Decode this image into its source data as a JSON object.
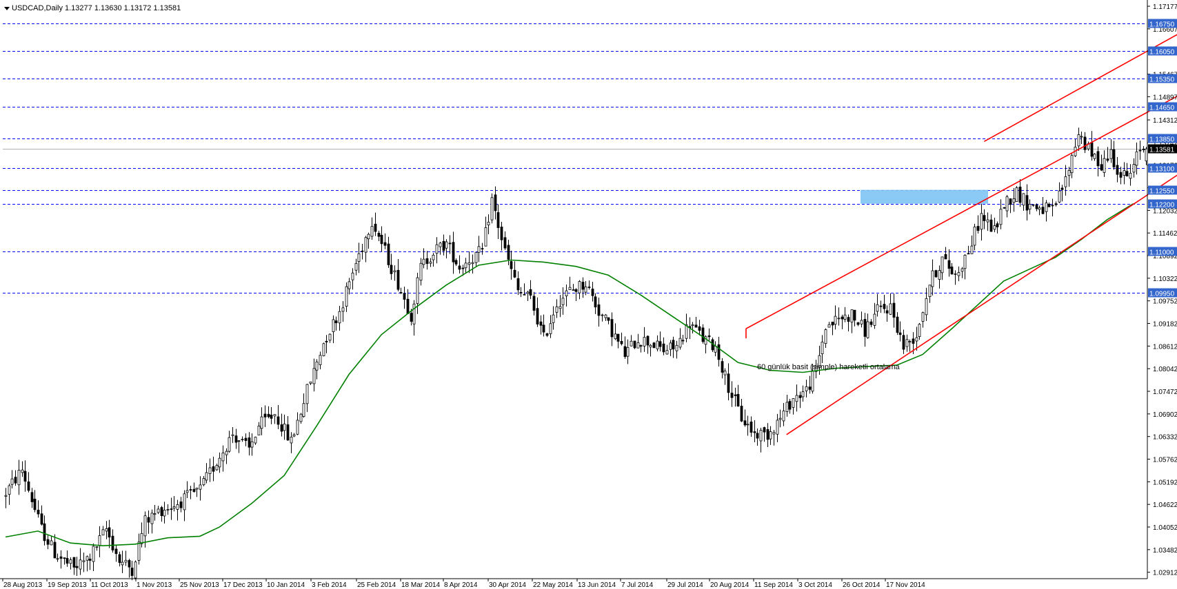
{
  "header": {
    "symbol_line": "USDCAD,Daily  1.13277 1.13630 1.13172 1.13581"
  },
  "annotation": {
    "text": "60 günlük basit (simple) hareketli ortalama"
  },
  "colors": {
    "candle": "#000000",
    "channel": "#ff0000",
    "ma": "#008000",
    "level_line": "#0000ff",
    "level_label_bg": "#3366cc",
    "current_label_bg": "#000000",
    "zone": "#7fc4f5"
  },
  "chart_data": {
    "type": "candlestick",
    "symbol": "USDCAD",
    "timeframe": "Daily",
    "last_bar": {
      "open": 1.13277,
      "high": 1.1363,
      "low": 1.13172,
      "close": 1.13581
    },
    "x_tick_labels": [
      "28 Aug 2013",
      "19 Sep 2013",
      "11 Oct 2013",
      "1 Nov 2013",
      "25 Nov 2013",
      "17 Dec 2013",
      "10 Jan 2014",
      "3 Feb 2014",
      "25 Feb 2014",
      "18 Mar 2014",
      "8 Apr 2014",
      "30 Apr 2014",
      "22 May 2014",
      "13 Jun 2014",
      "7 Jul 2014",
      "29 Jul 2014",
      "20 Aug 2014",
      "11 Sep 2014",
      "3 Oct 2014",
      "26 Oct 2014",
      "17 Nov 2014"
    ],
    "y_tick_labels": [
      "1.17177",
      "1.16607",
      "1.16037",
      "1.15467",
      "1.14897",
      "1.14312",
      "1.13742",
      "1.13172",
      "1.12602",
      "1.12032",
      "1.11462",
      "1.10892",
      "1.10322",
      "1.09752",
      "1.09182",
      "1.08612",
      "1.08042",
      "1.07472",
      "1.06902",
      "1.06332",
      "1.05762",
      "1.05192",
      "1.04622",
      "1.04052",
      "1.03482",
      "1.02912"
    ],
    "ylim": [
      1.0275,
      1.1723
    ],
    "horizontal_levels": [
      "1.16750",
      "1.16050",
      "1.15350",
      "1.14650",
      "1.13850",
      "1.13100",
      "1.12550",
      "1.12200",
      "1.11000",
      "1.09950"
    ],
    "current_price": "1.13581",
    "highlight_zone": {
      "from": 1.122,
      "to": 1.1255
    },
    "moving_average": {
      "period": 60,
      "type": "simple"
    },
    "price_path": [
      [
        0,
        1.048
      ],
      [
        6,
        1.055
      ],
      [
        12,
        1.04
      ],
      [
        16,
        1.034
      ],
      [
        22,
        1.03
      ],
      [
        27,
        1.033
      ],
      [
        32,
        1.04
      ],
      [
        36,
        1.032
      ],
      [
        40,
        1.03
      ],
      [
        44,
        1.042
      ],
      [
        49,
        1.045
      ],
      [
        53,
        1.046
      ],
      [
        57,
        1.048
      ],
      [
        61,
        1.05
      ],
      [
        66,
        1.057
      ],
      [
        71,
        1.064
      ],
      [
        76,
        1.06
      ],
      [
        79,
        1.066
      ],
      [
        84,
        1.069
      ],
      [
        89,
        1.062
      ],
      [
        94,
        1.075
      ],
      [
        99,
        1.087
      ],
      [
        104,
        1.095
      ],
      [
        109,
        1.107
      ],
      [
        114,
        1.118
      ],
      [
        118,
        1.11
      ],
      [
        122,
        1.102
      ],
      [
        126,
        1.094
      ],
      [
        129,
        1.106
      ],
      [
        133,
        1.11
      ],
      [
        137,
        1.112
      ],
      [
        141,
        1.106
      ],
      [
        144,
        1.108
      ],
      [
        148,
        1.11
      ],
      [
        151,
        1.123
      ],
      [
        155,
        1.11
      ],
      [
        159,
        1.1
      ],
      [
        163,
        1.098
      ],
      [
        167,
        1.088
      ],
      [
        171,
        1.097
      ],
      [
        175,
        1.1
      ],
      [
        180,
        1.102
      ],
      [
        184,
        1.095
      ],
      [
        188,
        1.09
      ],
      [
        192,
        1.084
      ],
      [
        196,
        1.088
      ],
      [
        200,
        1.087
      ],
      [
        204,
        1.085
      ],
      [
        208,
        1.086
      ],
      [
        212,
        1.092
      ],
      [
        216,
        1.088
      ],
      [
        220,
        1.086
      ],
      [
        224,
        1.076
      ],
      [
        228,
        1.068
      ],
      [
        232,
        1.064
      ],
      [
        236,
        1.064
      ],
      [
        240,
        1.068
      ],
      [
        244,
        1.073
      ],
      [
        248,
        1.075
      ],
      [
        251,
        1.08
      ],
      [
        254,
        1.091
      ],
      [
        258,
        1.093
      ],
      [
        262,
        1.094
      ],
      [
        266,
        1.09
      ],
      [
        270,
        1.095
      ],
      [
        274,
        1.096
      ],
      [
        278,
        1.086
      ],
      [
        282,
        1.089
      ],
      [
        286,
        1.102
      ],
      [
        290,
        1.108
      ],
      [
        294,
        1.104
      ],
      [
        298,
        1.11
      ],
      [
        302,
        1.119
      ],
      [
        306,
        1.115
      ],
      [
        309,
        1.122
      ],
      [
        313,
        1.125
      ],
      [
        316,
        1.122
      ],
      [
        320,
        1.121
      ],
      [
        324,
        1.12
      ],
      [
        328,
        1.128
      ],
      [
        332,
        1.14
      ],
      [
        336,
        1.134
      ],
      [
        339,
        1.132
      ],
      [
        342,
        1.135
      ],
      [
        345,
        1.129
      ],
      [
        348,
        1.129
      ],
      [
        351,
        1.136
      ],
      [
        352,
        1.1358
      ]
    ],
    "ma_path": [
      [
        0,
        1.038
      ],
      [
        10,
        1.0395
      ],
      [
        20,
        1.0365
      ],
      [
        30,
        1.0358
      ],
      [
        40,
        1.0362
      ],
      [
        50,
        1.0378
      ],
      [
        60,
        1.0382
      ],
      [
        66,
        1.0405
      ],
      [
        76,
        1.0465
      ],
      [
        86,
        1.0535
      ],
      [
        96,
        1.066
      ],
      [
        106,
        1.079
      ],
      [
        116,
        1.089
      ],
      [
        126,
        1.0955
      ],
      [
        136,
        1.1015
      ],
      [
        146,
        1.1065
      ],
      [
        156,
        1.1078
      ],
      [
        166,
        1.1073
      ],
      [
        176,
        1.1062
      ],
      [
        186,
        1.104
      ],
      [
        196,
        1.099
      ],
      [
        206,
        1.0935
      ],
      [
        216,
        1.088
      ],
      [
        226,
        1.082
      ],
      [
        236,
        1.08
      ],
      [
        246,
        1.0795
      ],
      [
        256,
        1.0805
      ],
      [
        266,
        1.081
      ],
      [
        275,
        1.0813
      ],
      [
        283,
        1.084
      ],
      [
        292,
        1.0905
      ],
      [
        300,
        1.0965
      ],
      [
        308,
        1.1025
      ],
      [
        316,
        1.1055
      ],
      [
        324,
        1.1085
      ],
      [
        332,
        1.113
      ],
      [
        340,
        1.118
      ],
      [
        348,
        1.122
      ]
    ],
    "channel_upper": {
      "from": [
        228.5,
        1.0905
      ],
      "to": [
        426,
        1.1775
      ]
    },
    "channel_lower": {
      "from": [
        241,
        1.0638
      ],
      "to": [
        441,
        1.1723
      ]
    },
    "channel_top_line": {
      "from": [
        302,
        1.1377
      ],
      "to": [
        390,
        1.1775
      ]
    }
  }
}
